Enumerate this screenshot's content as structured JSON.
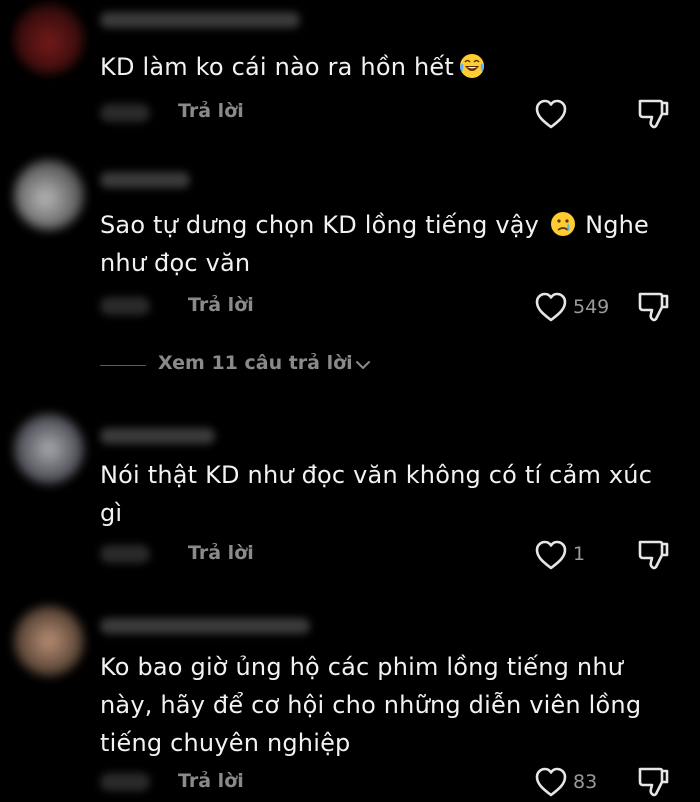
{
  "comments": [
    {
      "text": "KD làm ko cái nào ra hồn hết",
      "emoji": "laughing-tears-emoji",
      "reply_label": "Trả lời",
      "likes": ""
    },
    {
      "text": "Sao tự dưng chọn KD lồng tiếng vậy",
      "emoji": "crying-face-emoji",
      "text_after_emoji": "Nghe như đọc văn",
      "reply_label": "Trả lời",
      "likes": "549"
    },
    {
      "text": "Nói thật KD như đọc văn không có tí cảm xúc gì",
      "reply_label": "Trả lời",
      "likes": "1"
    },
    {
      "text": "Ko bao giờ ủng hộ các phim lồng tiếng như này, hãy để cơ hội cho những diễn viên lồng tiếng chuyên nghiệp",
      "reply_label": "Trả lời",
      "likes": "83"
    }
  ],
  "view_replies": {
    "label": "Xem 11 câu trả lời"
  },
  "colors": {
    "background": "#000000",
    "text": "#f2f2f2",
    "secondary": "#8a8a8a"
  },
  "icons": {
    "like": "heart-outline-icon",
    "dislike": "thumbs-down-outline-icon",
    "expand": "chevron-down-icon"
  }
}
